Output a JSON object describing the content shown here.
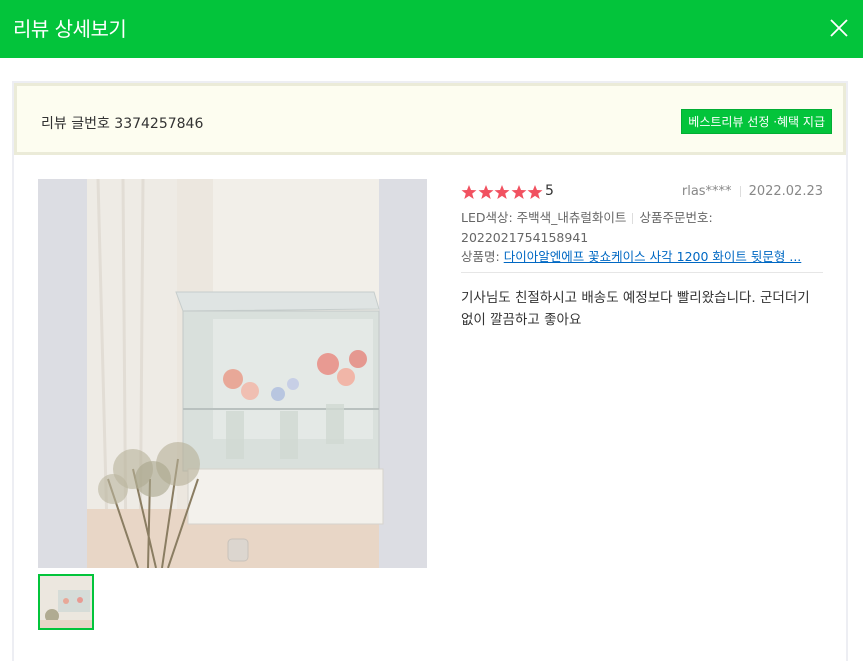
{
  "header": {
    "title": "리뷰 상세보기",
    "close_icon": "close-icon"
  },
  "info_bar": {
    "review_number": "리뷰 글번호 3374257846",
    "best_button": "베스트리뷰 선정 ·혜택 지급"
  },
  "review": {
    "rating_stars": 5,
    "rating": "5",
    "user": "rlas****",
    "date": "2022.02.23",
    "option": "LED색상: 주백색_내츄럴화이트",
    "order_no": "상품주문번호: 2022021754158941",
    "product_label": "상품명:",
    "product_name": "다이아알엔에프 꽃쇼케이스 사각 1200 화이트 뒷문형 ...",
    "content": "기사님도 친절하시고 배송도 예정보다 빨리왔습니다. 군더더기 없이 깔끔하고 좋아요"
  },
  "colors": {
    "header": "#03c43b",
    "star": "#f15160",
    "link": "#0068c3"
  }
}
